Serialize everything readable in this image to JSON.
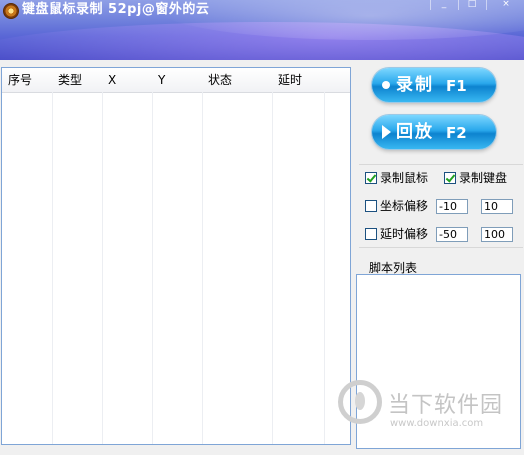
{
  "window": {
    "title": "键盘鼠标录制   52pj@窗外的云",
    "buttons": {
      "minimize": "_",
      "maximize": "□",
      "close": "×"
    }
  },
  "table": {
    "columns": [
      "序号",
      "类型",
      "X",
      "Y",
      "状态",
      "延时"
    ],
    "rows": []
  },
  "controls": {
    "record": {
      "label": "录制",
      "key": "F1",
      "icon": "record-dot-icon"
    },
    "playback": {
      "label": "回放",
      "key": "F2",
      "icon": "play-triangle-icon"
    }
  },
  "options": {
    "record_mouse": {
      "label": "录制鼠标",
      "checked": true
    },
    "record_keyboard": {
      "label": "录制键盘",
      "checked": true
    },
    "coord_offset": {
      "label": "坐标偏移",
      "checked": false,
      "min": "-10",
      "max": "10"
    },
    "delay_offset": {
      "label": "延时偏移",
      "checked": false,
      "min": "-50",
      "max": "100"
    }
  },
  "script_list": {
    "label": "脚本列表",
    "items": []
  },
  "watermark": {
    "text": "当下软件园",
    "url": "www.downxia.com"
  },
  "colors": {
    "titlebar": "#5a67d6",
    "button_blue": "#1a96e0",
    "check_green": "#21a121"
  }
}
